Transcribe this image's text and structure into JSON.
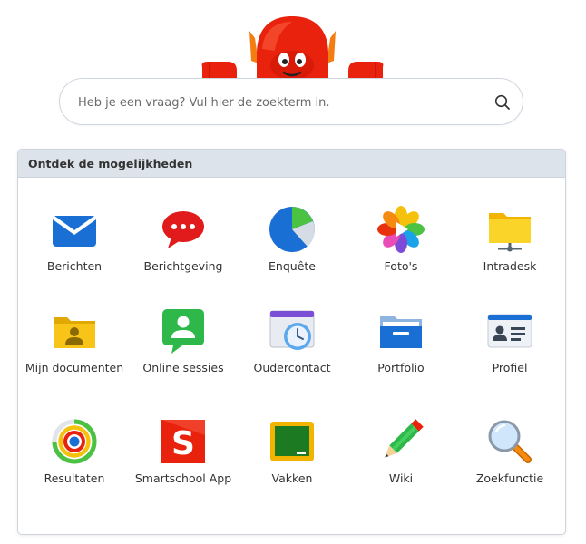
{
  "search": {
    "placeholder": "Heb je een vraag? Vul hier de zoekterm in.",
    "value": "",
    "icon": "search-icon"
  },
  "mascot": {
    "icon": "red-robot-mascot"
  },
  "panel": {
    "title": "Ontdek de mogelijkheden",
    "apps": [
      {
        "label": "Berichten",
        "icon": "envelope-icon"
      },
      {
        "label": "Berichtgeving",
        "icon": "speech-bubble-icon"
      },
      {
        "label": "Enquête",
        "icon": "pie-chart-icon"
      },
      {
        "label": "Foto's",
        "icon": "photos-icon"
      },
      {
        "label": "Intradesk",
        "icon": "shared-folder-icon"
      },
      {
        "label": "Mijn documenten",
        "icon": "user-folder-icon"
      },
      {
        "label": "Online sessies",
        "icon": "video-user-icon"
      },
      {
        "label": "Oudercontact",
        "icon": "calendar-clock-icon"
      },
      {
        "label": "Portfolio",
        "icon": "portfolio-folder-icon"
      },
      {
        "label": "Profiel",
        "icon": "id-card-icon"
      },
      {
        "label": "Resultaten",
        "icon": "rings-chart-icon"
      },
      {
        "label": "Smartschool App",
        "icon": "smartschool-s-icon"
      },
      {
        "label": "Vakken",
        "icon": "chalkboard-icon"
      },
      {
        "label": "Wiki",
        "icon": "pencil-icon"
      },
      {
        "label": "Zoekfunctie",
        "icon": "magnifier-icon"
      }
    ]
  },
  "colors": {
    "header_bg": "#dde3ea",
    "mascot_red": "#e8220c",
    "envelope_blue": "#1a6fd4",
    "folder_yellow": "#f5c518"
  }
}
